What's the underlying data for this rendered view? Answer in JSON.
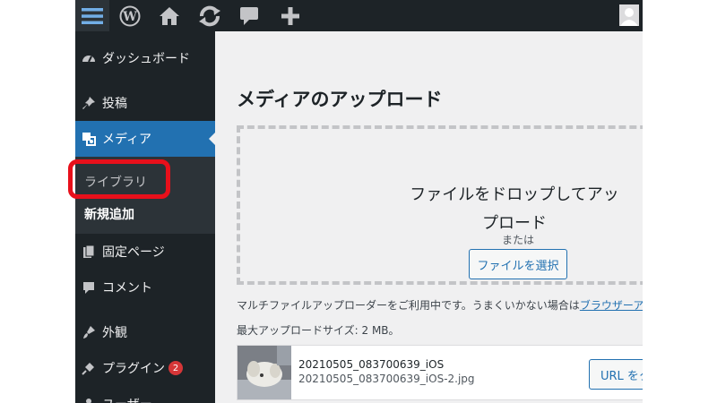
{
  "adminbar": {
    "icons": [
      "menu-icon",
      "wordpress-icon",
      "home-icon",
      "update-icon",
      "comment-icon",
      "plus-icon",
      "avatar"
    ]
  },
  "sidebar": {
    "dashboard": "ダッシュボード",
    "posts": "投稿",
    "media": "メディア",
    "media_sub": {
      "library": "ライブラリ",
      "add_new": "新規追加"
    },
    "pages": "固定ページ",
    "comments": "コメント",
    "appearance": "外観",
    "plugins": "プラグイン",
    "plugins_badge": "2",
    "users": "ユーザー"
  },
  "main": {
    "title": "メディアのアップロード",
    "drop_text": "ファイルをドロップしてアップロード",
    "or": "または",
    "select_button": "ファイルを選択",
    "info_text": "マルチファイルアップローダーをご利用中です。うまくいかない場合は",
    "info_link": "ブラウザーアップロ",
    "max_size": "最大アップロードサイズ: 2 MB。",
    "uploaded": {
      "title": "20210505_083700639_iOS",
      "filename": "20210505_083700639_iOS-2.jpg",
      "copy_button": "URL をク"
    }
  },
  "colors": {
    "dark": "#1d2327",
    "active": "#2271b1",
    "highlight": "#e8101b",
    "badge": "#d63638"
  }
}
